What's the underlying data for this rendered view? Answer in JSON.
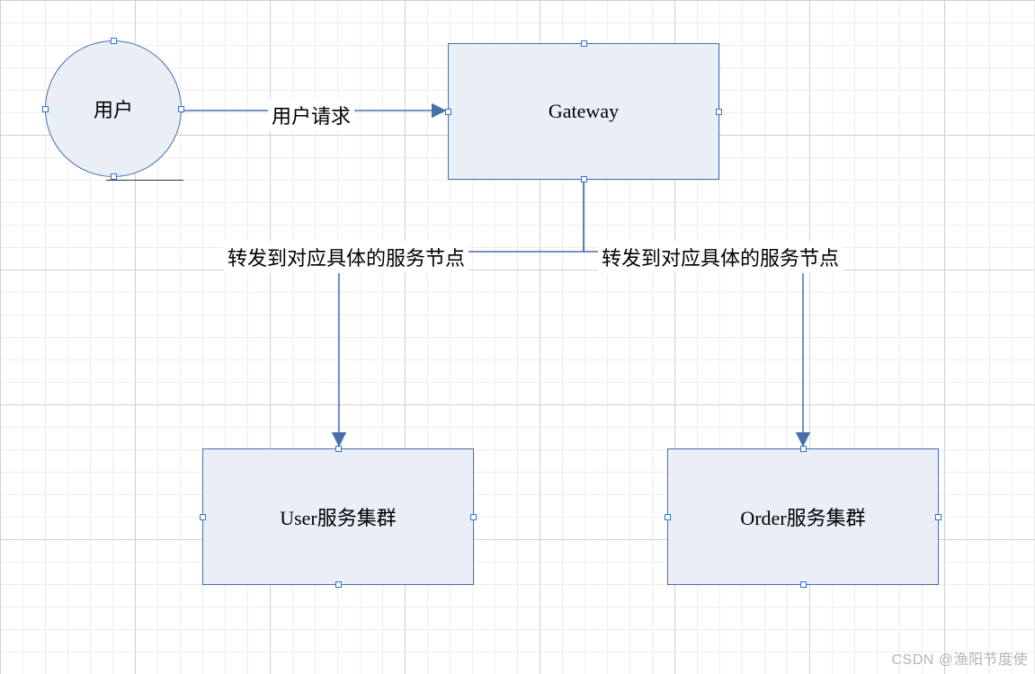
{
  "nodes": {
    "user": {
      "label": "用户"
    },
    "gateway": {
      "label": "Gateway"
    },
    "userSvc": {
      "label": "User服务集群"
    },
    "orderSvc": {
      "label": "Order服务集群"
    }
  },
  "edges": {
    "userRequest": {
      "label": "用户请求"
    },
    "toUser": {
      "label": "转发到对应具体的服务节点"
    },
    "toOrder": {
      "label": "转发到对应具体的服务节点"
    }
  },
  "colors": {
    "nodeFill": "#eaeff7",
    "nodeStroke": "#4a6ea9",
    "edge": "#4a6ea9",
    "handle": "#2e75d6"
  },
  "watermark": "CSDN @渔阳节度使"
}
